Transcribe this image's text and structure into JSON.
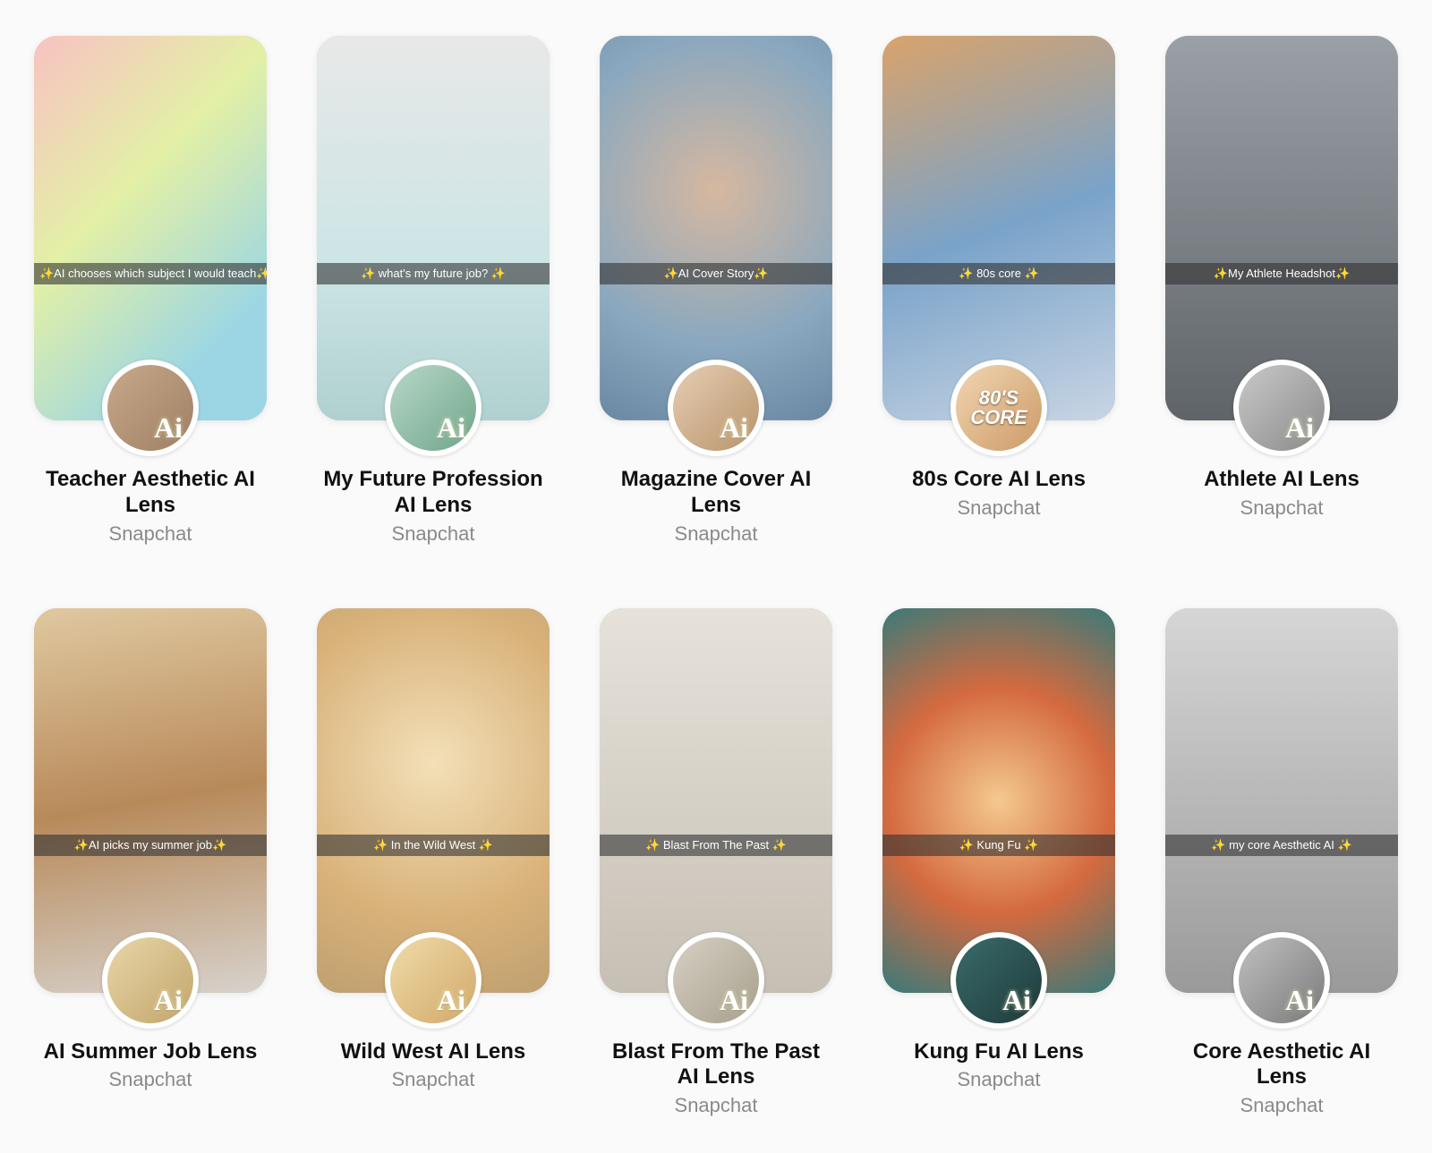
{
  "lenses": [
    {
      "title": "Teacher Aesthetic AI Lens",
      "creator": "Snapchat",
      "caption": "✨AI chooses which subject I would teach✨",
      "avatar_ai_text": "Ai",
      "eighties_badge": ""
    },
    {
      "title": "My Future Profession AI Lens",
      "creator": "Snapchat",
      "caption": "✨ what's my future job? ✨",
      "avatar_ai_text": "Ai",
      "eighties_badge": ""
    },
    {
      "title": "Magazine Cover AI Lens",
      "creator": "Snapchat",
      "caption": "✨AI Cover Story✨",
      "avatar_ai_text": "Ai",
      "eighties_badge": ""
    },
    {
      "title": "80s Core AI Lens",
      "creator": "Snapchat",
      "caption": "✨ 80s core ✨",
      "avatar_ai_text": "",
      "eighties_badge": "80'S CORE"
    },
    {
      "title": "Athlete AI Lens",
      "creator": "Snapchat",
      "caption": "✨My Athlete Headshot✨",
      "avatar_ai_text": "Ai",
      "eighties_badge": ""
    },
    {
      "title": "AI Summer Job Lens",
      "creator": "Snapchat",
      "caption": "✨AI picks my summer job✨",
      "avatar_ai_text": "Ai",
      "eighties_badge": ""
    },
    {
      "title": "Wild West AI Lens",
      "creator": "Snapchat",
      "caption": "✨ In the Wild West ✨",
      "avatar_ai_text": "Ai",
      "eighties_badge": ""
    },
    {
      "title": "Blast From The Past AI Lens",
      "creator": "Snapchat",
      "caption": "✨ Blast From The Past ✨",
      "avatar_ai_text": "Ai",
      "eighties_badge": ""
    },
    {
      "title": "Kung Fu AI Lens",
      "creator": "Snapchat",
      "caption": "✨ Kung Fu ✨",
      "avatar_ai_text": "Ai",
      "eighties_badge": ""
    },
    {
      "title": "Core Aesthetic AI Lens",
      "creator": "Snapchat",
      "caption": "✨ my core Aesthetic AI ✨",
      "avatar_ai_text": "Ai",
      "eighties_badge": ""
    }
  ]
}
